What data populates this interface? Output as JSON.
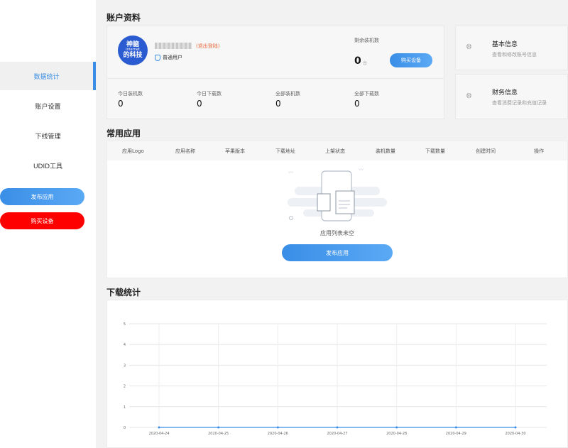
{
  "sidebar": {
    "items": [
      {
        "label": "数据统计",
        "active": true
      },
      {
        "label": "账户设置",
        "active": false
      },
      {
        "label": "下线管理",
        "active": false
      },
      {
        "label": "UDID工具",
        "active": false
      }
    ],
    "publish_label": "发布应用",
    "buy_label": "购买设备"
  },
  "account": {
    "title": "账户资料",
    "logo_line1": "神脑",
    "logo_line2": "internet",
    "logo_line3": "的科技",
    "logout": "(退出登陆)",
    "user_type": "普通用户",
    "remain_label": "剩余装机数",
    "remain_value": "0",
    "remain_unit": "台",
    "buy_button": "购买设备",
    "stats": [
      {
        "label": "今日装机数",
        "value": "0"
      },
      {
        "label": "今日下载数",
        "value": "0"
      },
      {
        "label": "全部装机数",
        "value": "0"
      },
      {
        "label": "全部下载数",
        "value": "0"
      }
    ]
  },
  "info_cards": [
    {
      "title": "基本信息",
      "desc": "查看和修改账号信息",
      "icon": "gear-icon"
    },
    {
      "title": "财务信息",
      "desc": "查看消费记录和充值记录",
      "icon": "gear-icon"
    }
  ],
  "apps": {
    "title": "常用应用",
    "columns": [
      "应用Logo",
      "应用名称",
      "苹果版本",
      "下载地址",
      "上架状态",
      "装机数量",
      "下载数量",
      "创建时间",
      "操作"
    ],
    "empty_text": "应用列表未空",
    "publish_button": "发布应用"
  },
  "downloads": {
    "title": "下载统计"
  },
  "chart_data": {
    "type": "line",
    "x": [
      "2020-04-24",
      "2020-04-25",
      "2020-04-26",
      "2020-04-27",
      "2020-04-28",
      "2020-04-29",
      "2020-04-30"
    ],
    "series": [
      {
        "values": [
          0,
          0,
          0,
          0,
          0,
          0,
          0
        ]
      }
    ],
    "yticks": [
      "0",
      "1",
      "2",
      "3",
      "4",
      "5"
    ],
    "ylim": [
      0,
      5
    ],
    "grid": true,
    "color": "#3a8ee6"
  }
}
